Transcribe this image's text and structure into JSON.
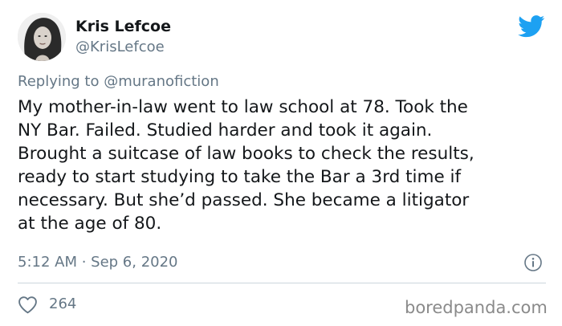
{
  "tweet": {
    "author": {
      "display_name": "Kris Lefcoe",
      "handle": "@KrisLefcoe",
      "avatar_icon": "profile-photo"
    },
    "reply": {
      "prefix": "Replying to",
      "mention": "@muranofiction"
    },
    "text": "My mother-in-law went to law school at 78. Took the\nNY Bar. Failed. Studied harder and took it again.\nBrought a suitcase of law books to check the results,\nready to start studying to take the Bar a 3rd time if\nnecessary. But she’d passed. She became a litigator\nat the age of 80.",
    "timestamp": "5:12 AM · Sep 6, 2020",
    "likes": "264"
  },
  "icons": {
    "brand": "twitter-bird-icon",
    "info": "info-icon",
    "like": "heart-icon"
  },
  "colors": {
    "twitter_blue": "#1da1f2",
    "text_primary": "#14171a",
    "text_secondary": "#657786",
    "divider": "#ccd6dd",
    "watermark": "#8a8a8a"
  },
  "watermark": "boredpanda.com"
}
